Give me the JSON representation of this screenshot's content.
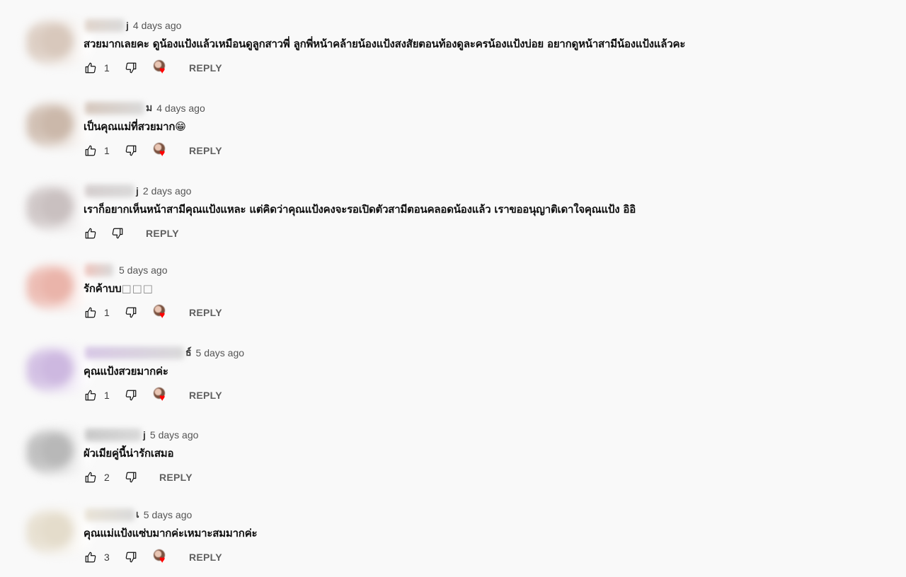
{
  "comments": [
    {
      "author_tail": "j",
      "time": "4 days ago",
      "text": "สวยมากเลยคะ ดูน้องแป้งแล้วเหมือนดูลูกสาวพี่ ลูกพี่หน้าคล้ายน้องแป้งสงสัยตอนท้องดูละครน้องแป้งบ่อย อยากดูหน้าสามีน้องแป้งแล้วคะ",
      "likes": "1",
      "hearted": true,
      "reply_label": "REPLY",
      "avatar_color": "#d8c8bc"
    },
    {
      "author_tail": "ม",
      "time": "4 days ago",
      "text": "เป็นคุณแม่ที่สวยมาก😁",
      "likes": "1",
      "hearted": true,
      "reply_label": "REPLY",
      "avatar_color": "#cbb8aa"
    },
    {
      "author_tail": "j",
      "time": "2 days ago",
      "text": "เราก็อยากเห็นหน้าสามีคุณแป้งแหละ แต่คิดว่าคุณแป้งคงจะรอเปิดตัวสามีตอนคลอดน้องแล้ว เราขออนุญาติเดาใจคุณแป้ง อิอิ",
      "likes": "",
      "hearted": false,
      "reply_label": "REPLY",
      "avatar_color": "#c9c0c0"
    },
    {
      "author_tail": "",
      "time": "5 days ago",
      "text": "รักค้าบบ",
      "text_suffix": "□□□",
      "likes": "1",
      "hearted": true,
      "reply_label": "REPLY",
      "avatar_color": "#eab4aa"
    },
    {
      "author_tail": "ธ์",
      "time": "5 days ago",
      "text": "คุณแป้งสวยมากค่ะ",
      "likes": "1",
      "hearted": true,
      "reply_label": "REPLY",
      "avatar_color": "#cdb8e0"
    },
    {
      "author_tail": "j",
      "time": "5 days ago",
      "text": "ผัวเมียคู่นี้น่ารักเสมอ",
      "likes": "2",
      "hearted": false,
      "reply_label": "REPLY",
      "avatar_color": "#b8b8b8"
    },
    {
      "author_tail": "เ",
      "time": "5 days ago",
      "text": "คุณแม่แป้งแซ่บมากค่ะเหมาะสมมากค่ะ",
      "likes": "3",
      "hearted": true,
      "reply_label": "REPLY",
      "avatar_color": "#e4dccb"
    }
  ],
  "icons": {
    "like": "thumbs-up-icon",
    "dislike": "thumbs-down-icon",
    "heart": "heart-icon"
  },
  "colors": {
    "heart": "#ff0000",
    "meta_text": "#606060",
    "background": "#f9f9f9"
  }
}
